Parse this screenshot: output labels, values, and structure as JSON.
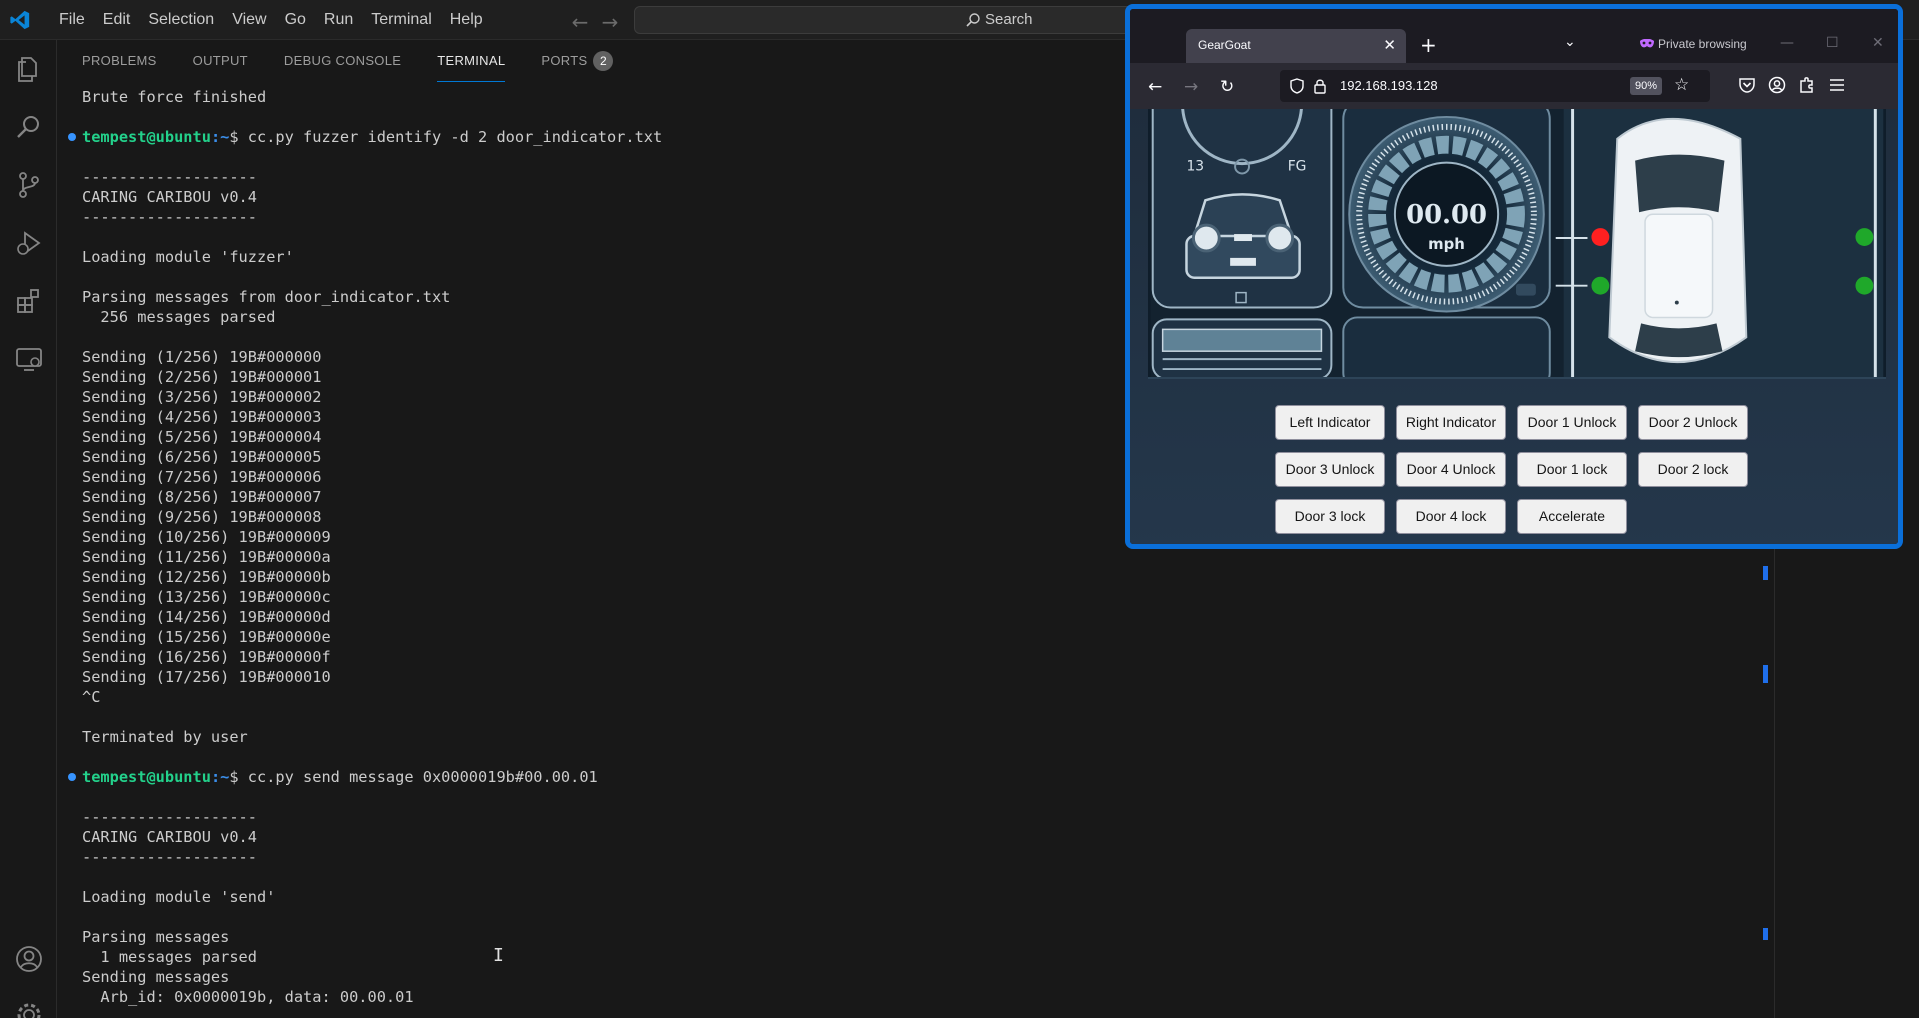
{
  "vscode": {
    "menu": [
      "File",
      "Edit",
      "Selection",
      "View",
      "Go",
      "Run",
      "Terminal",
      "Help"
    ],
    "search_label": "Search"
  },
  "panel": {
    "tabs": [
      "PROBLEMS",
      "OUTPUT",
      "DEBUG CONSOLE",
      "TERMINAL",
      "PORTS"
    ],
    "ports_badge": "2"
  },
  "terminal": {
    "prompt_user": "tempest@ubuntu",
    "prompt_path": ":~",
    "prompt_symbol": "$ ",
    "lines": [
      {
        "text": "Brute force finished"
      },
      {
        "text": ""
      },
      {
        "prompt": true,
        "cmd": "cc.py fuzzer identify -d 2 door_indicator.txt"
      },
      {
        "text": ""
      },
      {
        "text": "-------------------"
      },
      {
        "text": "CARING CARIBOU v0.4"
      },
      {
        "text": "-------------------"
      },
      {
        "text": ""
      },
      {
        "text": "Loading module 'fuzzer'"
      },
      {
        "text": ""
      },
      {
        "text": "Parsing messages from door_indicator.txt"
      },
      {
        "text": "  256 messages parsed"
      },
      {
        "text": ""
      },
      {
        "text": "Sending (1/256) 19B#000000"
      },
      {
        "text": "Sending (2/256) 19B#000001"
      },
      {
        "text": "Sending (3/256) 19B#000002"
      },
      {
        "text": "Sending (4/256) 19B#000003"
      },
      {
        "text": "Sending (5/256) 19B#000004"
      },
      {
        "text": "Sending (6/256) 19B#000005"
      },
      {
        "text": "Sending (7/256) 19B#000006"
      },
      {
        "text": "Sending (8/256) 19B#000007"
      },
      {
        "text": "Sending (9/256) 19B#000008"
      },
      {
        "text": "Sending (10/256) 19B#000009"
      },
      {
        "text": "Sending (11/256) 19B#00000a"
      },
      {
        "text": "Sending (12/256) 19B#00000b"
      },
      {
        "text": "Sending (13/256) 19B#00000c"
      },
      {
        "text": "Sending (14/256) 19B#00000d"
      },
      {
        "text": "Sending (15/256) 19B#00000e"
      },
      {
        "text": "Sending (16/256) 19B#00000f"
      },
      {
        "text": "Sending (17/256) 19B#000010"
      },
      {
        "text": "^C"
      },
      {
        "text": ""
      },
      {
        "text": "Terminated by user"
      },
      {
        "text": ""
      },
      {
        "prompt": true,
        "cmd": "cc.py send message 0x0000019b#00.00.01"
      },
      {
        "text": ""
      },
      {
        "text": "-------------------"
      },
      {
        "text": "CARING CARIBOU v0.4"
      },
      {
        "text": "-------------------"
      },
      {
        "text": ""
      },
      {
        "text": "Loading module 'send'"
      },
      {
        "text": ""
      },
      {
        "text": "Parsing messages"
      },
      {
        "text": "  1 messages parsed"
      },
      {
        "text": "Sending messages"
      },
      {
        "text": "  Arb_id: 0x0000019b, data: 00.00.01"
      }
    ]
  },
  "browser": {
    "tab_title": "GearGoat",
    "private_label": "Private browsing",
    "url": "192.168.193.128",
    "zoom": "90%",
    "speedometer_value": "00.00",
    "speedometer_unit": "mph",
    "gauge_left_label": "13",
    "gauge_right_label": "FG",
    "buttons": [
      "Left Indicator",
      "Right Indicator",
      "Door 1 Unlock",
      "Door 2 Unlock",
      "Door 3 Unlock",
      "Door 4 Unlock",
      "Door 1 lock",
      "Door 2 lock",
      "Door 3 lock",
      "Door 4 lock",
      "Accelerate"
    ]
  },
  "colors": {
    "accent": "#0078d4",
    "prompt_user": "#23d18b",
    "prompt_path": "#3b8eea",
    "indicator_red": "#ff2020",
    "indicator_green": "#1fa82a"
  }
}
